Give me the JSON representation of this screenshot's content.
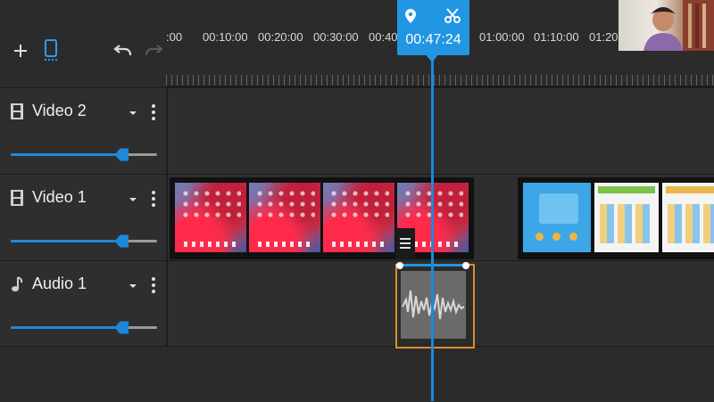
{
  "toolbar": {
    "add_icon": "plus-icon",
    "select_icon": "phone-select-icon",
    "undo_icon": "undo-icon",
    "redo_icon": "redo-icon"
  },
  "ruler": {
    "labels": [
      ":00",
      "00:10:00",
      "00:20:00",
      "00:30:00",
      "00:40:",
      "01:00:00",
      "01:10:00",
      "01:20:"
    ]
  },
  "playhead": {
    "time": "00:47:24",
    "marker_icon": "map-pin-icon",
    "cut_icon": "scissors-icon",
    "accent": "#2196e3"
  },
  "tracks": [
    {
      "name": "Video 2",
      "icon": "film-icon",
      "volume": 0.76
    },
    {
      "name": "Video 1",
      "icon": "film-icon",
      "volume": 0.76
    },
    {
      "name": "Audio 1",
      "icon": "music-note-icon",
      "volume": 0.76
    }
  ],
  "colors": {
    "accent": "#1e88d8",
    "audio_clip_border": "#e08a2a",
    "background": "#2b2b2b"
  }
}
